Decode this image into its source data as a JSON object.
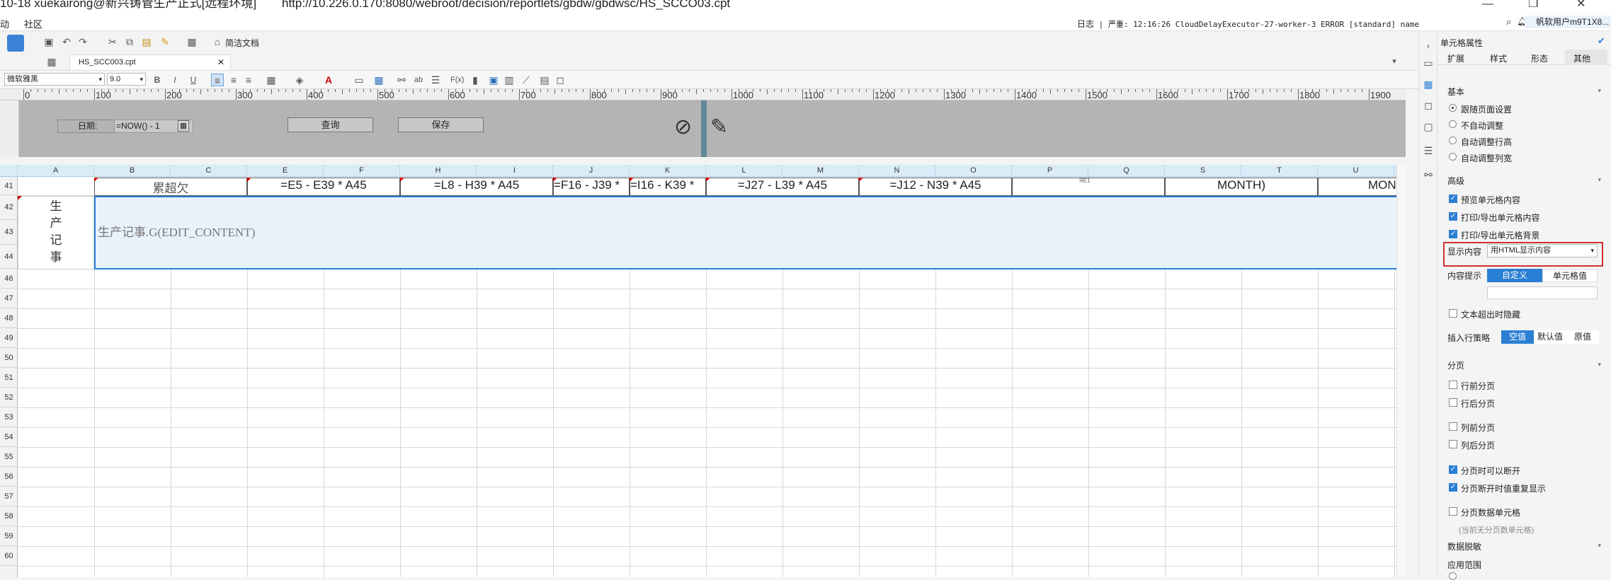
{
  "window": {
    "title": "10-18 xuekairong@新兴铸管生产正式[远程环境]",
    "url": "http://10.226.0.170:8080/webroot/decision/reportlets/gbdw/gbdwsc/HS_SCCO03.cpt"
  },
  "menubar": {
    "items": [
      "动",
      "社区"
    ],
    "log_label": "日志",
    "log_text": "| 严重: 12:16:26 CloudDelayExecutor-27-worker-3 ERROR [standard] name",
    "user": "帆软用户m9T1X8..."
  },
  "toolbar": {
    "cleanup_label": "简洁文档",
    "file_tab": "HS_SCC003.cpt",
    "font_family": "微软雅黑",
    "font_size": "9.0"
  },
  "ruler": {
    "labels": [
      "0",
      "100",
      "200",
      "300",
      "400",
      "500",
      "600",
      "700",
      "800",
      "900",
      "1000",
      "1100",
      "1200",
      "1300",
      "1400",
      "1500",
      "1600",
      "1700",
      "1800",
      "1900"
    ]
  },
  "param_panel": {
    "date_label": "日期:",
    "date_value": "=NOW() - 1",
    "query_button": "查询",
    "save_button": "保存"
  },
  "grid": {
    "columns": [
      "A",
      "B",
      "C",
      "E",
      "F",
      "H",
      "I",
      "J",
      "K",
      "L",
      "M",
      "N",
      "O",
      "P",
      "Q",
      "S",
      "T",
      "U"
    ],
    "rows": [
      "41",
      "42",
      "43",
      "44",
      "46",
      "47",
      "48",
      "49",
      "50",
      "51",
      "52",
      "53",
      "54",
      "55",
      "56",
      "57",
      "58",
      "59",
      "60"
    ],
    "row41_cells": [
      "累超欠",
      "=E5 - E39 * A45",
      "=L8 - H39 * A45",
      "=F16 - J39 *",
      "=I16 - K39 *",
      "=J27 - L39 * A45",
      "=J12 - N39 * A45",
      "MONTH)",
      "MON"
    ],
    "small_text": "ЯЕ1",
    "row42_label": [
      "生",
      "产",
      "记",
      "事"
    ],
    "row42_formula": "生产记事.G(EDIT_CONTENT)"
  },
  "panel": {
    "title": "单元格属性",
    "tabs": [
      "扩展",
      "样式",
      "形态",
      "其他"
    ],
    "basic": {
      "header": "基本",
      "options": [
        "跟随页面设置",
        "不自动调整",
        "自动调整行高",
        "自动调整列宽"
      ],
      "selected_index": 0
    },
    "advanced": {
      "header": "高级",
      "checks": [
        "预览单元格内容",
        "打印/导出单元格内容",
        "打印/导出单元格背景"
      ],
      "display_label": "显示内容",
      "display_value": "用HTML显示内容",
      "tooltip_label": "内容提示",
      "tooltip_options": [
        "自定义",
        "单元格值"
      ],
      "overflow_hide": "文本超出时隐藏",
      "insert_label": "插入行策略",
      "insert_options": [
        "空值",
        "默认值",
        "原值"
      ]
    },
    "paging": {
      "header": "分页",
      "options": [
        "行前分页",
        "行后分页",
        "列前分页",
        "列后分页",
        "分页时可以断开",
        "分页断开时值重复显示",
        "分页数据单元格"
      ],
      "checked": [
        false,
        false,
        false,
        false,
        true,
        true,
        false
      ],
      "note": "(当前无分页数单元格)"
    },
    "mask": {
      "header": "数据脱敏",
      "scope_label": "应用范围"
    }
  },
  "colors": {
    "accent": "#2a7fd4",
    "highlight_border": "#d13030",
    "param_bg": "#b4b4b4",
    "selection_bg": "#e8f2fb"
  }
}
